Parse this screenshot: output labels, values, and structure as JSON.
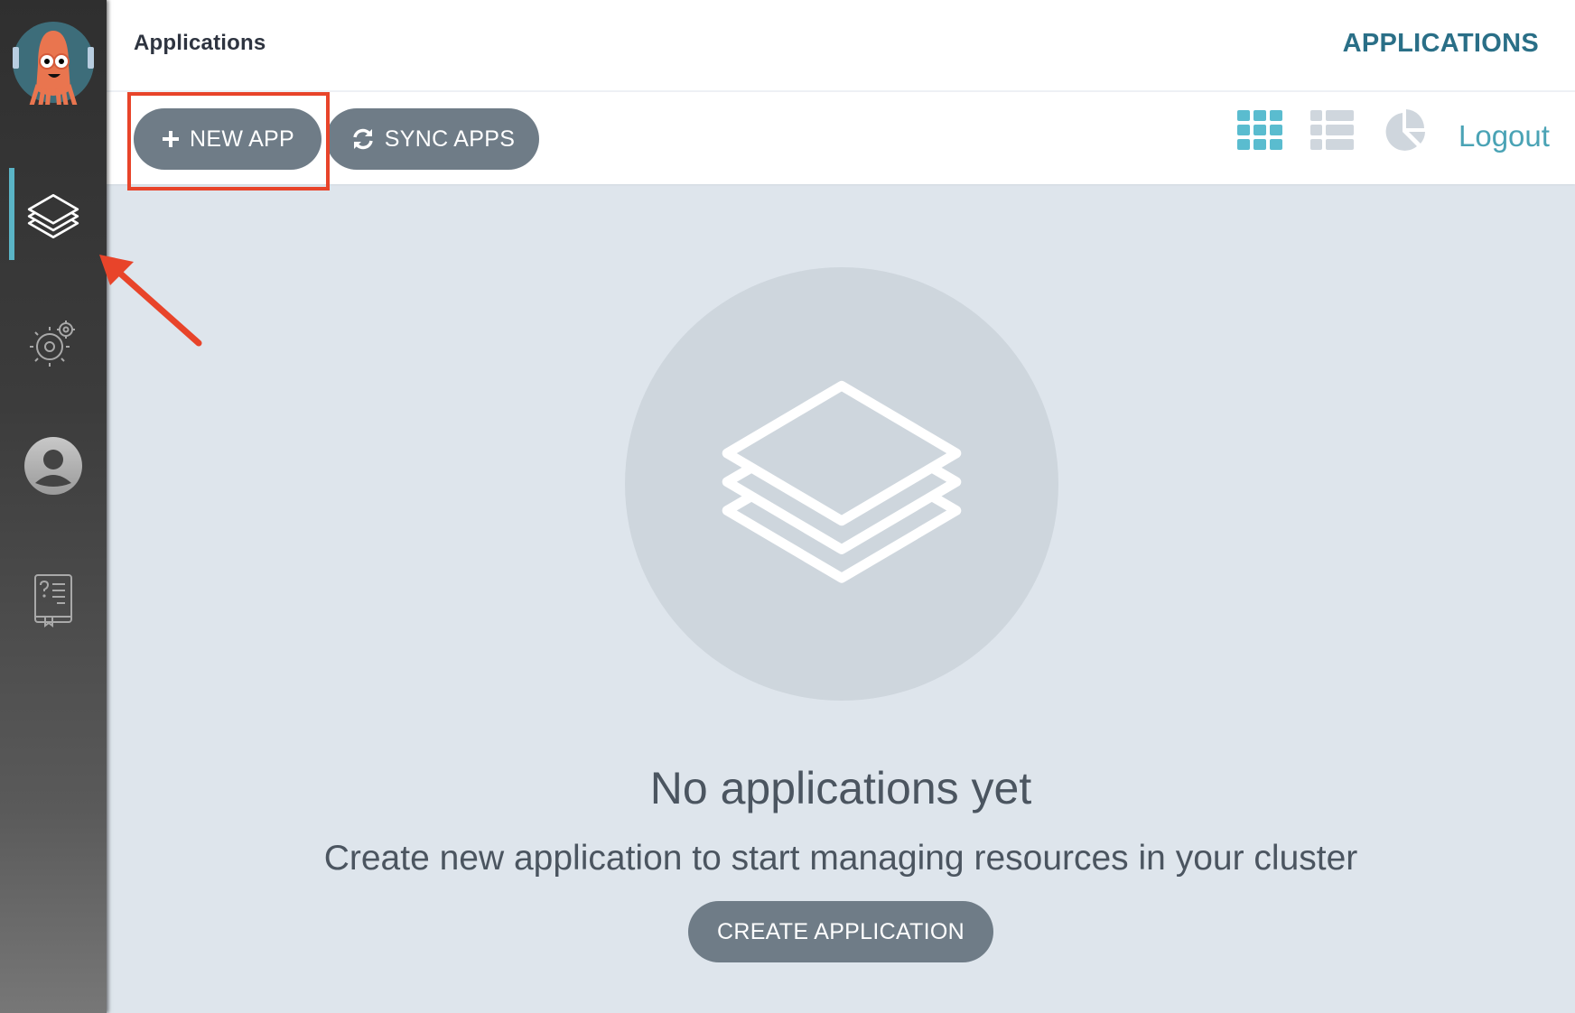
{
  "sidebar": {
    "logo": "argo-octopus-logo",
    "items": [
      {
        "name": "applications",
        "icon": "layers-icon",
        "active": true
      },
      {
        "name": "settings",
        "icon": "gears-icon",
        "active": false
      },
      {
        "name": "user-info",
        "icon": "user-icon",
        "active": false
      },
      {
        "name": "documentation",
        "icon": "help-book-icon",
        "active": false
      }
    ],
    "active_color": "#5ab4c6"
  },
  "header": {
    "title": "Applications",
    "top_link": "APPLICATIONS"
  },
  "toolbar": {
    "new_app_label": "NEW APP",
    "sync_apps_label": "SYNC APPS",
    "views": [
      {
        "name": "tiles",
        "icon": "grid-icon",
        "active": true
      },
      {
        "name": "list",
        "icon": "list-icon",
        "active": false
      },
      {
        "name": "summary",
        "icon": "pie-chart-icon",
        "active": false
      }
    ],
    "logout_label": "Logout"
  },
  "empty_state": {
    "icon": "layers-icon",
    "title": "No applications yet",
    "subtitle": "Create new application to start managing resources in your cluster",
    "create_label": "CREATE APPLICATION"
  },
  "annotations": {
    "highlight": "red-box-around-new-app",
    "arrow": "red-arrow-pointing-to-applications-nav",
    "color": "#e8442a"
  }
}
